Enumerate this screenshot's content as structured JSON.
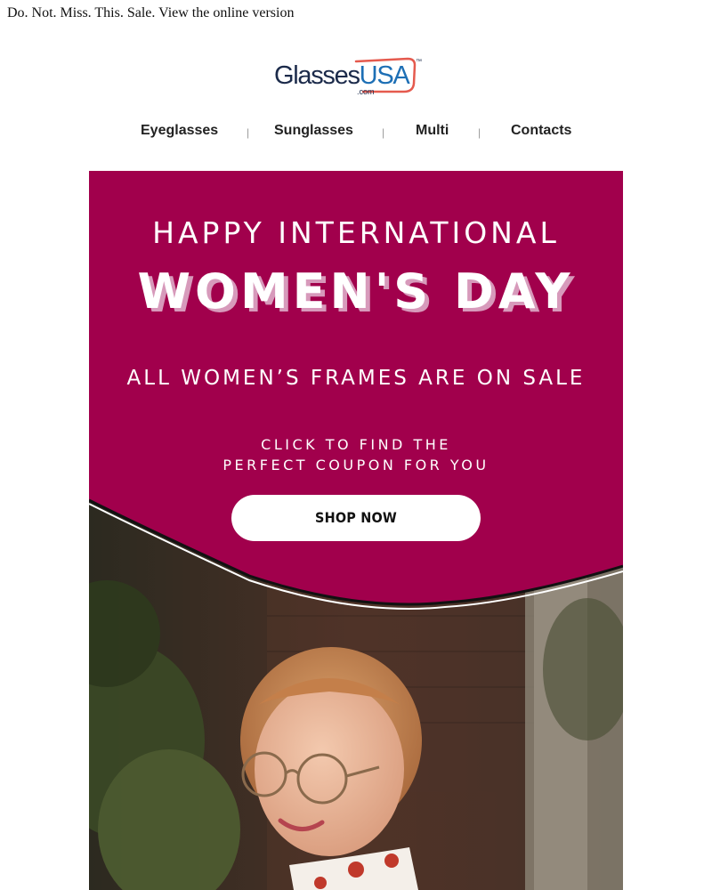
{
  "preheader": {
    "text": "Do. Not. Miss. This. Sale.",
    "link": "View the online version"
  },
  "logo": {
    "name": "GlassesUSA",
    "word": "Glasses",
    "accent": "USA",
    "domain": ".com",
    "tm": "™",
    "colors": {
      "navy": "#1b2a4a",
      "accent": "#e55a4e"
    }
  },
  "nav": {
    "items": [
      "Eyeglasses",
      "Sunglasses",
      "Multi",
      "Contacts"
    ],
    "separator": "|"
  },
  "hero": {
    "line1": "HAPPY INTERNATIONAL",
    "line2": "WOMEN'S DAY",
    "line3": "ALL WOMEN’S FRAMES ARE ON SALE",
    "line4a": "CLICK TO FIND THE",
    "line4b": "PERFECT COUPON FOR YOU",
    "cta": "SHOP NOW",
    "colors": {
      "background": "#a1004c",
      "shadow": "#d79abb"
    },
    "image": "woman-with-glasses-photo"
  }
}
